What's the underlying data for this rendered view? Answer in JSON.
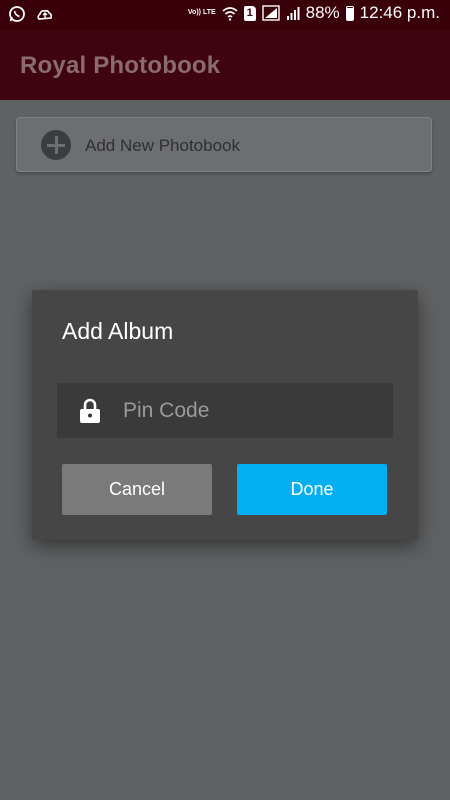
{
  "status_bar": {
    "network_label": "Vo)) LTE",
    "sim_slot": "1",
    "battery": "88%",
    "time": "12:46 p.m."
  },
  "app_bar": {
    "title": "Royal Photobook"
  },
  "main": {
    "add_new_label": "Add New Photobook"
  },
  "dialog": {
    "title": "Add Album",
    "pin_placeholder": "Pin Code",
    "pin_value": "",
    "cancel_label": "Cancel",
    "done_label": "Done"
  },
  "colors": {
    "status_bar": "#3a0009",
    "app_bar": "#3f0410",
    "done_button": "#03aff0",
    "cancel_button": "#7a7a7a",
    "dialog_bg": "#464646"
  },
  "icons": {
    "status_left": [
      "whatsapp-icon",
      "cloud-upload-icon"
    ],
    "status_right": [
      "volte-icon",
      "wifi-icon",
      "sim-icon",
      "signal-icon",
      "battery-icon"
    ],
    "add": "add-circle-icon",
    "pin": "lock-icon"
  }
}
